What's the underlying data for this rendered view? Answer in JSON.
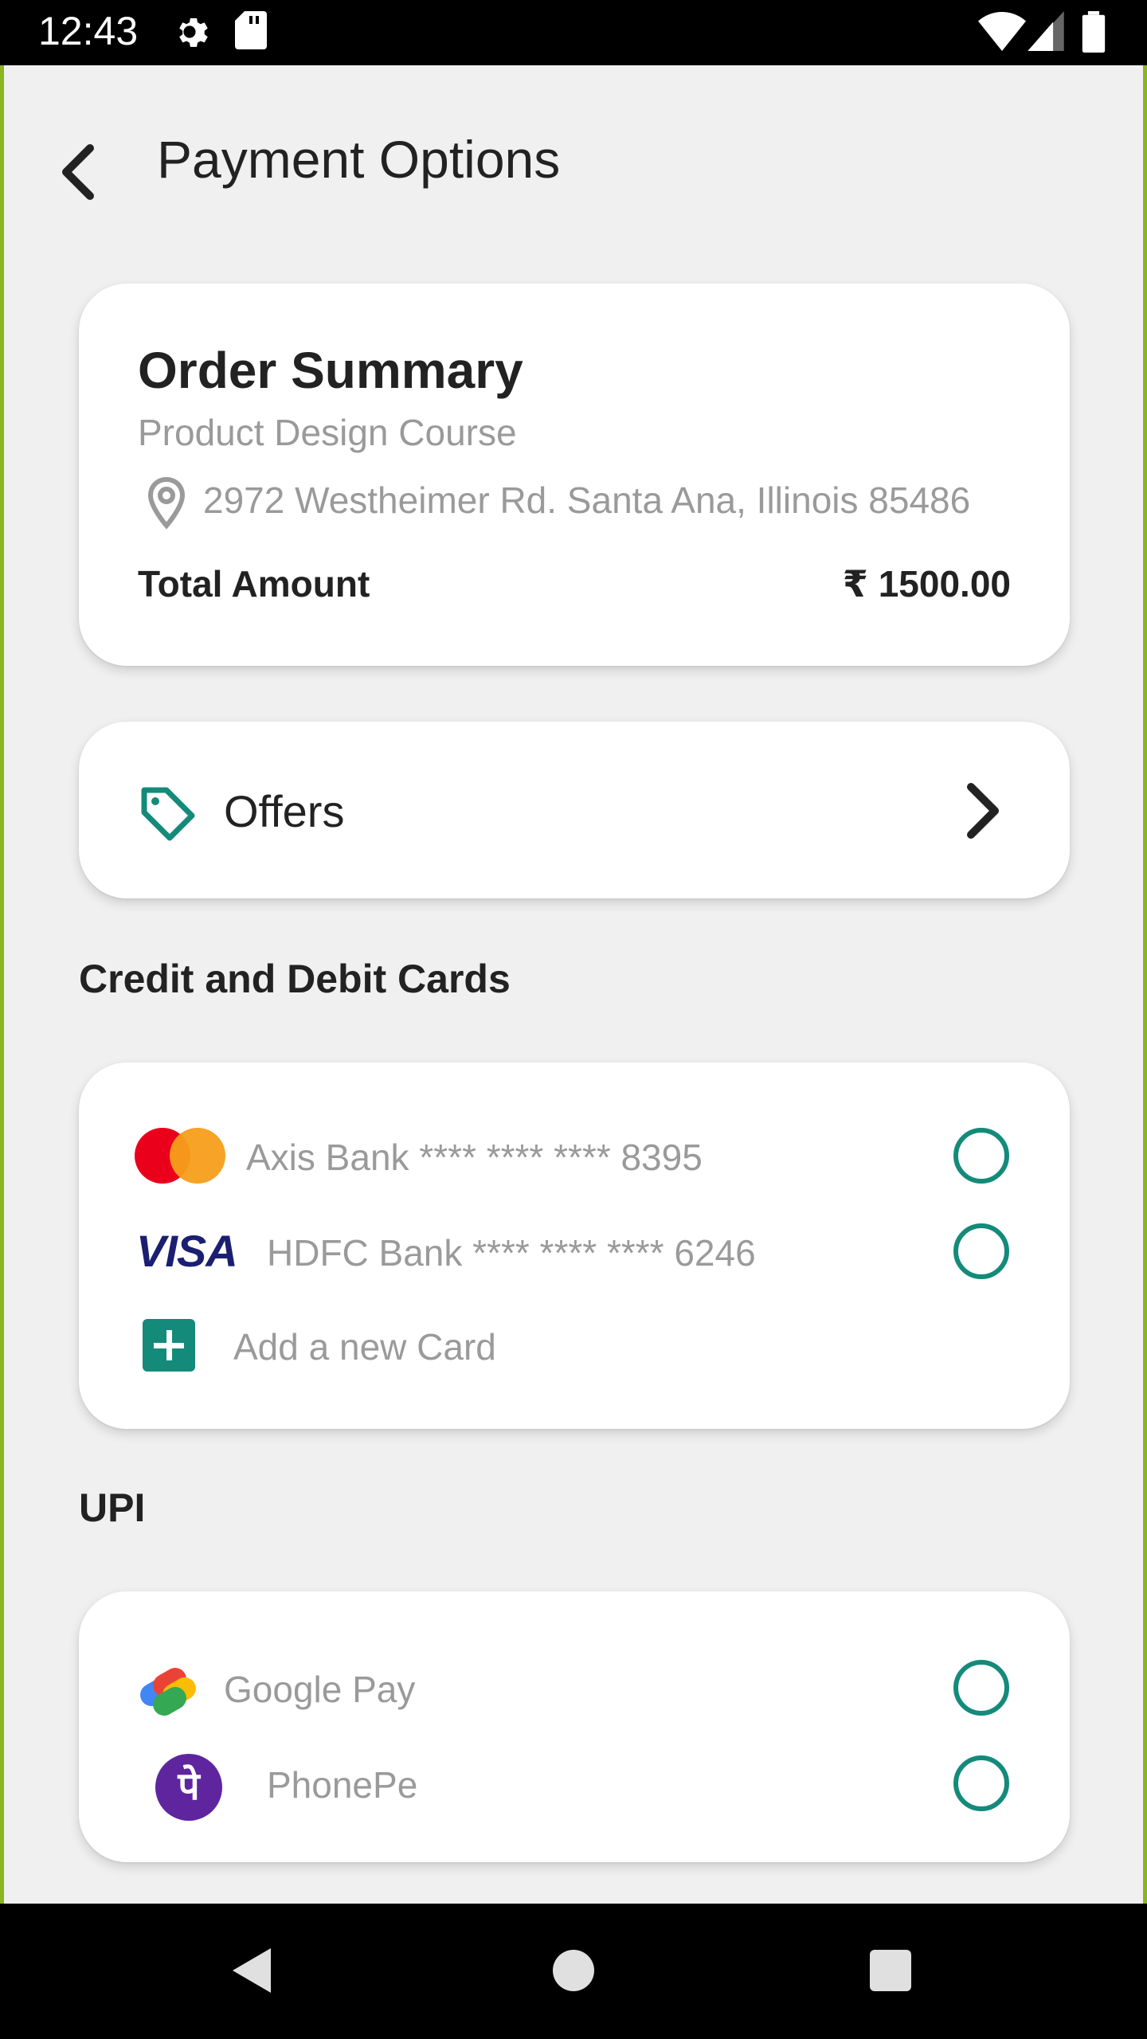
{
  "status_bar": {
    "time": "12:43"
  },
  "header": {
    "title": "Payment Options"
  },
  "order_summary": {
    "title": "Order Summary",
    "product": "Product Design Course",
    "address": "2972 Westheimer Rd. Santa Ana, Illinois 85486",
    "total_label": "Total Amount",
    "total_value": "₹ 1500.00"
  },
  "offers": {
    "label": "Offers"
  },
  "cards_section": {
    "heading": "Credit and Debit Cards",
    "items": [
      {
        "brand": "mastercard-icon",
        "label": "Axis Bank **** **** **** 8395"
      },
      {
        "brand": "visa-icon",
        "brand_text": "VISA",
        "label": "HDFC Bank **** **** **** 6246"
      }
    ],
    "add_label": "Add a new Card"
  },
  "upi_section": {
    "heading": "UPI",
    "items": [
      {
        "icon": "google-pay-icon",
        "label": "Google Pay"
      },
      {
        "icon": "phonepe-icon",
        "icon_text": "पे",
        "label": "PhonePe"
      }
    ]
  },
  "colors": {
    "accent": "#148a7a",
    "text": "#222222",
    "muted": "#9a9a9a",
    "frame": "#8ab51d"
  }
}
